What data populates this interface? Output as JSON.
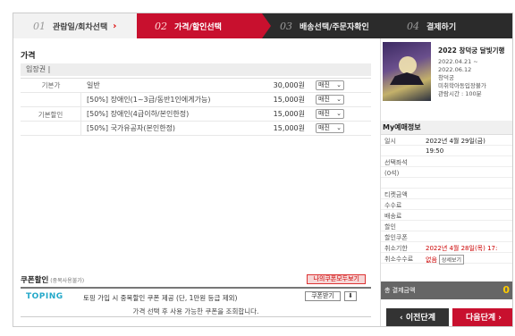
{
  "steps": [
    {
      "num": "01",
      "label": "관람일/회차선택",
      "arrow": "›"
    },
    {
      "num": "02",
      "label": "가격/할인선택"
    },
    {
      "num": "03",
      "label": "배송선택/주문자확인"
    },
    {
      "num": "04",
      "label": "결제하기"
    }
  ],
  "price": {
    "section_title": "가격",
    "sub_header": "입장권 |",
    "rows": [
      {
        "category": "기본가",
        "name": "일반",
        "price": "30,000원",
        "select": "매진"
      },
      {
        "category": "",
        "name": "[50%] 장애인(1~3급/동반1인에게가능)",
        "price": "15,000원",
        "select": "매진"
      },
      {
        "category": "",
        "name": "[50%] 장애인(4급이하/본인한정)",
        "price": "15,000원",
        "select": "매진"
      },
      {
        "category": "",
        "name": "[50%] 국가유공자(본인한정)",
        "price": "15,000원",
        "select": "매진"
      }
    ],
    "discount_category": "기본할인"
  },
  "coupon": {
    "title": "쿠폰할인",
    "note": "(중복사용불가)",
    "my_coupon_button": "나의쿠폰모두보기",
    "brand": "TOPING",
    "promo_text": "토핑 가입 시 중복할인 쿠폰 제공 (단, 1만원 등급 제외)",
    "receive_button": "쿠폰받기",
    "message": "가격 선택 후 사용 가능한 쿠폰을 조회합니다."
  },
  "show": {
    "title": "2022 창덕궁 달빛기행",
    "period_start": "2022.04.21 ~",
    "period_end": "2022.06.12",
    "venue": "창덕궁",
    "age": "미취학아동입장불가",
    "runtime": "관람시간 : 100분"
  },
  "reservation": {
    "title": "My예매정보",
    "rows": [
      {
        "key": "일시",
        "value": "2022년 4월 29일(금)"
      },
      {
        "key": "",
        "value": "19:50"
      },
      {
        "key": "선택좌석",
        "value": ""
      },
      {
        "key": "(0석)",
        "value": ""
      },
      {
        "key": "",
        "value": ""
      },
      {
        "key": "티켓금액",
        "value": ""
      },
      {
        "key": "수수료",
        "value": ""
      },
      {
        "key": "배송료",
        "value": ""
      },
      {
        "key": "할인",
        "value": ""
      },
      {
        "key": "할인쿠폰",
        "value": ""
      },
      {
        "key": "취소기한",
        "value": "2022년 4월 28일(목) 17:"
      },
      {
        "key": "취소수수료",
        "value": "없음"
      }
    ],
    "detail_button": "상세보기",
    "total_label": "총 결제금액",
    "total_amount": "0"
  },
  "nav": {
    "prev": "‹ 이전단계",
    "next": "다음단계 ›"
  }
}
